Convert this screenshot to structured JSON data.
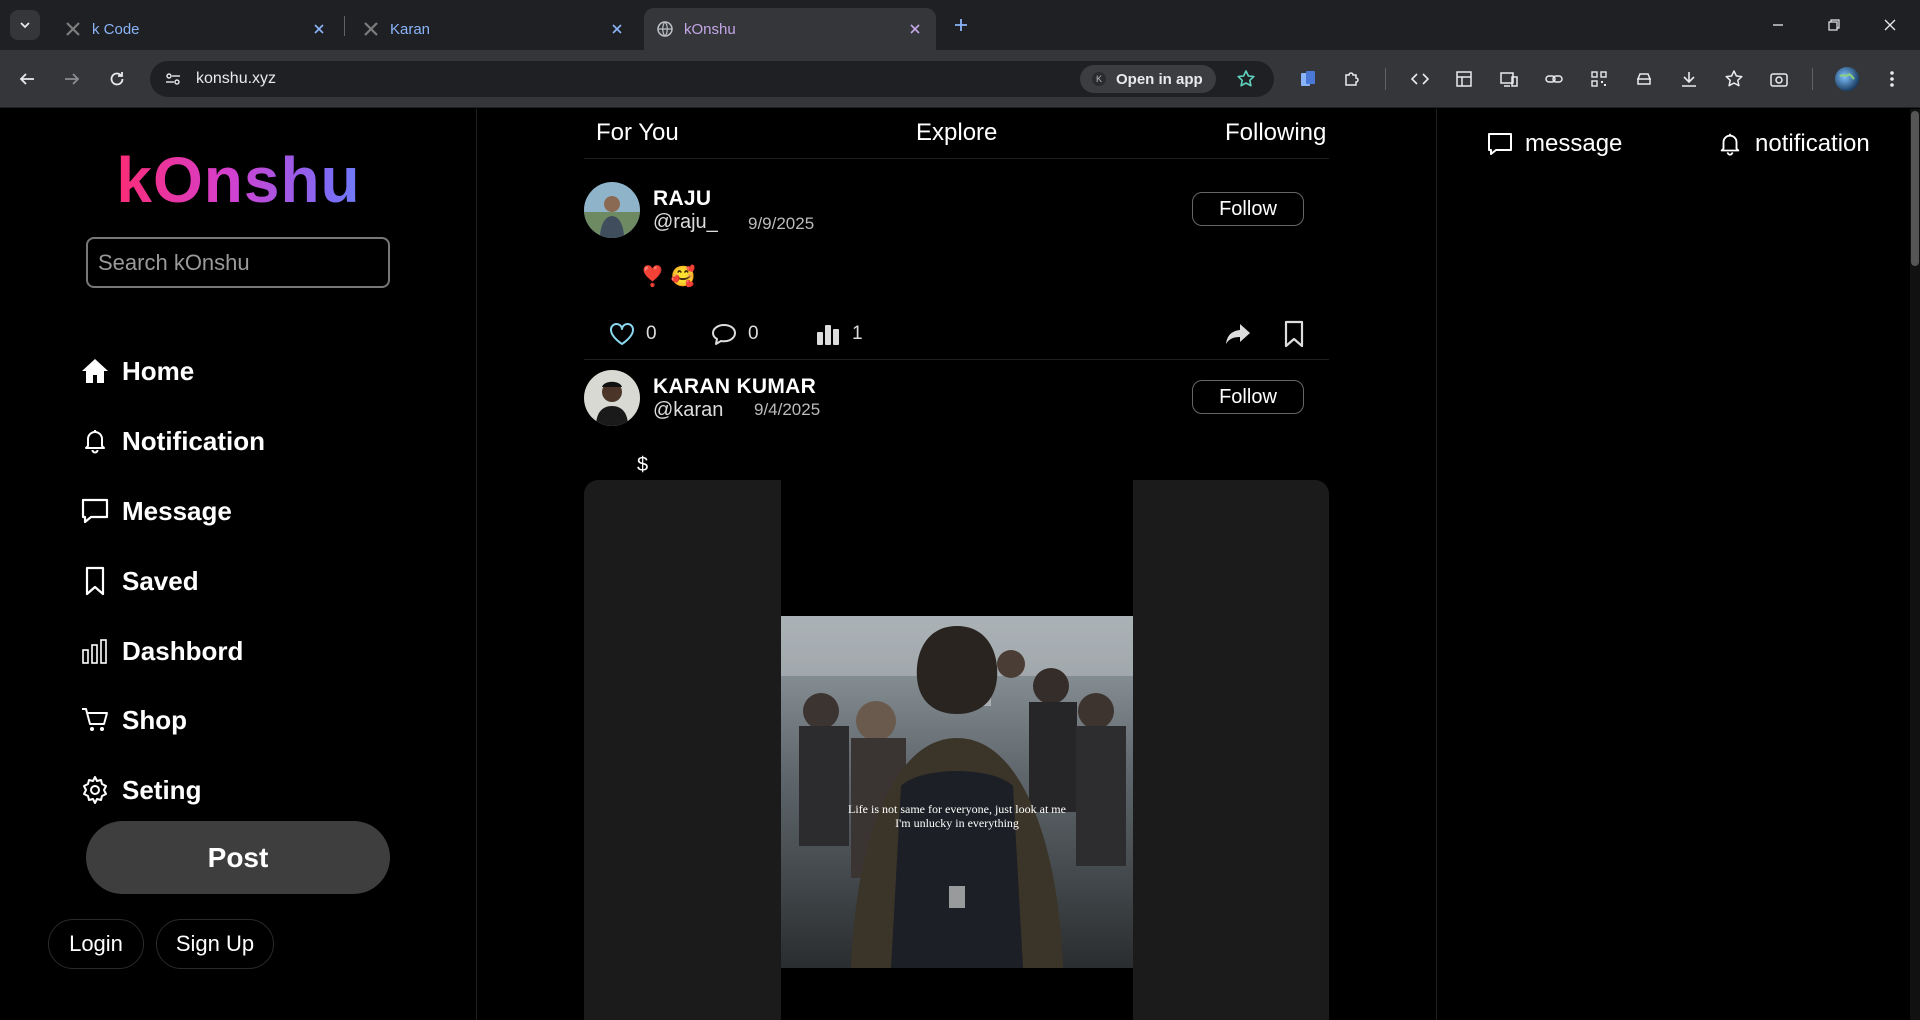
{
  "browser": {
    "tabs": [
      {
        "title": "k Code",
        "active": false
      },
      {
        "title": "Karan",
        "active": false
      },
      {
        "title": "kOnshu",
        "active": true
      }
    ],
    "url": "konshu.xyz",
    "open_in_app_label": "Open in app",
    "open_in_app_badge": "K"
  },
  "sidebar": {
    "logo": "kOnshu",
    "search_placeholder": "Search kOnshu",
    "nav": [
      {
        "label": "Home",
        "icon": "home-icon"
      },
      {
        "label": "Notification",
        "icon": "bell-icon"
      },
      {
        "label": "Message",
        "icon": "message-icon"
      },
      {
        "label": "Saved",
        "icon": "bookmark-icon"
      },
      {
        "label": "Dashbord",
        "icon": "bar-chart-icon"
      },
      {
        "label": "Shop",
        "icon": "cart-icon"
      },
      {
        "label": "Seting",
        "icon": "gear-icon"
      }
    ],
    "post_label": "Post",
    "login_label": "Login",
    "signup_label": "Sign Up"
  },
  "feed": {
    "tabs": [
      "For You",
      "Explore",
      "Following"
    ],
    "posts": [
      {
        "name": "RAJU",
        "handle": "@raju_",
        "date": "9/9/2025",
        "follow_label": "Follow",
        "body": "❣️ 🥰",
        "likes": "0",
        "comments": "0",
        "views": "1"
      },
      {
        "name": "KARAN KUMAR",
        "handle": "@karan",
        "date": "9/4/2025",
        "follow_label": "Follow",
        "body": "$",
        "image_caption_line1": "Life is not same for everyone, just look at me",
        "image_caption_line2": "I'm unlucky in everything"
      }
    ]
  },
  "right_panel": {
    "message_label": "message",
    "notification_label": "notification"
  },
  "colors": {
    "background": "#000000",
    "logo_gradient_start": "#ff0f3a",
    "logo_gradient_end": "#3fc8ff",
    "like_icon": "#8ad7ee",
    "star_icon": "#5fd3c0"
  }
}
